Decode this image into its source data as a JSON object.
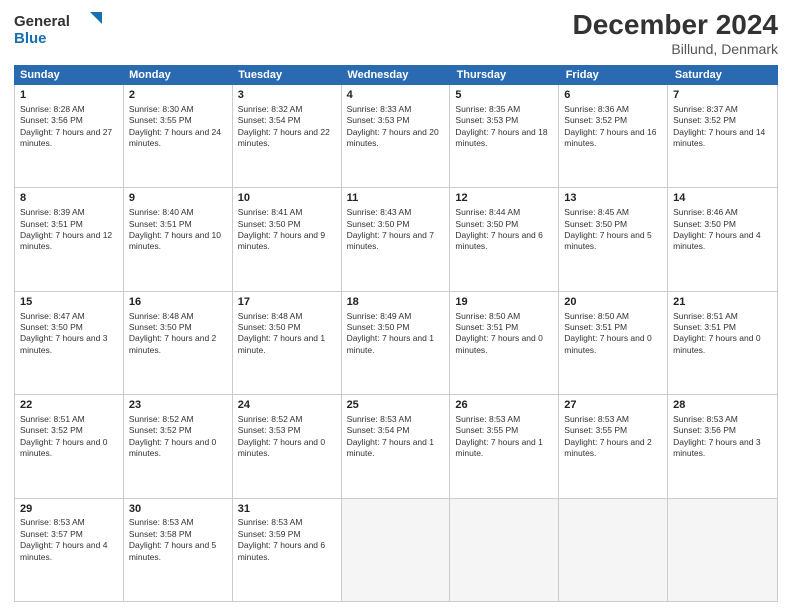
{
  "header": {
    "logo_general": "General",
    "logo_blue": "Blue",
    "title": "December 2024",
    "subtitle": "Billund, Denmark"
  },
  "days": [
    "Sunday",
    "Monday",
    "Tuesday",
    "Wednesday",
    "Thursday",
    "Friday",
    "Saturday"
  ],
  "weeks": [
    [
      {
        "num": "1",
        "sunrise": "Sunrise: 8:28 AM",
        "sunset": "Sunset: 3:56 PM",
        "daylight": "Daylight: 7 hours and 27 minutes."
      },
      {
        "num": "2",
        "sunrise": "Sunrise: 8:30 AM",
        "sunset": "Sunset: 3:55 PM",
        "daylight": "Daylight: 7 hours and 24 minutes."
      },
      {
        "num": "3",
        "sunrise": "Sunrise: 8:32 AM",
        "sunset": "Sunset: 3:54 PM",
        "daylight": "Daylight: 7 hours and 22 minutes."
      },
      {
        "num": "4",
        "sunrise": "Sunrise: 8:33 AM",
        "sunset": "Sunset: 3:53 PM",
        "daylight": "Daylight: 7 hours and 20 minutes."
      },
      {
        "num": "5",
        "sunrise": "Sunrise: 8:35 AM",
        "sunset": "Sunset: 3:53 PM",
        "daylight": "Daylight: 7 hours and 18 minutes."
      },
      {
        "num": "6",
        "sunrise": "Sunrise: 8:36 AM",
        "sunset": "Sunset: 3:52 PM",
        "daylight": "Daylight: 7 hours and 16 minutes."
      },
      {
        "num": "7",
        "sunrise": "Sunrise: 8:37 AM",
        "sunset": "Sunset: 3:52 PM",
        "daylight": "Daylight: 7 hours and 14 minutes."
      }
    ],
    [
      {
        "num": "8",
        "sunrise": "Sunrise: 8:39 AM",
        "sunset": "Sunset: 3:51 PM",
        "daylight": "Daylight: 7 hours and 12 minutes."
      },
      {
        "num": "9",
        "sunrise": "Sunrise: 8:40 AM",
        "sunset": "Sunset: 3:51 PM",
        "daylight": "Daylight: 7 hours and 10 minutes."
      },
      {
        "num": "10",
        "sunrise": "Sunrise: 8:41 AM",
        "sunset": "Sunset: 3:50 PM",
        "daylight": "Daylight: 7 hours and 9 minutes."
      },
      {
        "num": "11",
        "sunrise": "Sunrise: 8:43 AM",
        "sunset": "Sunset: 3:50 PM",
        "daylight": "Daylight: 7 hours and 7 minutes."
      },
      {
        "num": "12",
        "sunrise": "Sunrise: 8:44 AM",
        "sunset": "Sunset: 3:50 PM",
        "daylight": "Daylight: 7 hours and 6 minutes."
      },
      {
        "num": "13",
        "sunrise": "Sunrise: 8:45 AM",
        "sunset": "Sunset: 3:50 PM",
        "daylight": "Daylight: 7 hours and 5 minutes."
      },
      {
        "num": "14",
        "sunrise": "Sunrise: 8:46 AM",
        "sunset": "Sunset: 3:50 PM",
        "daylight": "Daylight: 7 hours and 4 minutes."
      }
    ],
    [
      {
        "num": "15",
        "sunrise": "Sunrise: 8:47 AM",
        "sunset": "Sunset: 3:50 PM",
        "daylight": "Daylight: 7 hours and 3 minutes."
      },
      {
        "num": "16",
        "sunrise": "Sunrise: 8:48 AM",
        "sunset": "Sunset: 3:50 PM",
        "daylight": "Daylight: 7 hours and 2 minutes."
      },
      {
        "num": "17",
        "sunrise": "Sunrise: 8:48 AM",
        "sunset": "Sunset: 3:50 PM",
        "daylight": "Daylight: 7 hours and 1 minute."
      },
      {
        "num": "18",
        "sunrise": "Sunrise: 8:49 AM",
        "sunset": "Sunset: 3:50 PM",
        "daylight": "Daylight: 7 hours and 1 minute."
      },
      {
        "num": "19",
        "sunrise": "Sunrise: 8:50 AM",
        "sunset": "Sunset: 3:51 PM",
        "daylight": "Daylight: 7 hours and 0 minutes."
      },
      {
        "num": "20",
        "sunrise": "Sunrise: 8:50 AM",
        "sunset": "Sunset: 3:51 PM",
        "daylight": "Daylight: 7 hours and 0 minutes."
      },
      {
        "num": "21",
        "sunrise": "Sunrise: 8:51 AM",
        "sunset": "Sunset: 3:51 PM",
        "daylight": "Daylight: 7 hours and 0 minutes."
      }
    ],
    [
      {
        "num": "22",
        "sunrise": "Sunrise: 8:51 AM",
        "sunset": "Sunset: 3:52 PM",
        "daylight": "Daylight: 7 hours and 0 minutes."
      },
      {
        "num": "23",
        "sunrise": "Sunrise: 8:52 AM",
        "sunset": "Sunset: 3:52 PM",
        "daylight": "Daylight: 7 hours and 0 minutes."
      },
      {
        "num": "24",
        "sunrise": "Sunrise: 8:52 AM",
        "sunset": "Sunset: 3:53 PM",
        "daylight": "Daylight: 7 hours and 0 minutes."
      },
      {
        "num": "25",
        "sunrise": "Sunrise: 8:53 AM",
        "sunset": "Sunset: 3:54 PM",
        "daylight": "Daylight: 7 hours and 1 minute."
      },
      {
        "num": "26",
        "sunrise": "Sunrise: 8:53 AM",
        "sunset": "Sunset: 3:55 PM",
        "daylight": "Daylight: 7 hours and 1 minute."
      },
      {
        "num": "27",
        "sunrise": "Sunrise: 8:53 AM",
        "sunset": "Sunset: 3:55 PM",
        "daylight": "Daylight: 7 hours and 2 minutes."
      },
      {
        "num": "28",
        "sunrise": "Sunrise: 8:53 AM",
        "sunset": "Sunset: 3:56 PM",
        "daylight": "Daylight: 7 hours and 3 minutes."
      }
    ],
    [
      {
        "num": "29",
        "sunrise": "Sunrise: 8:53 AM",
        "sunset": "Sunset: 3:57 PM",
        "daylight": "Daylight: 7 hours and 4 minutes."
      },
      {
        "num": "30",
        "sunrise": "Sunrise: 8:53 AM",
        "sunset": "Sunset: 3:58 PM",
        "daylight": "Daylight: 7 hours and 5 minutes."
      },
      {
        "num": "31",
        "sunrise": "Sunrise: 8:53 AM",
        "sunset": "Sunset: 3:59 PM",
        "daylight": "Daylight: 7 hours and 6 minutes."
      },
      null,
      null,
      null,
      null
    ]
  ]
}
